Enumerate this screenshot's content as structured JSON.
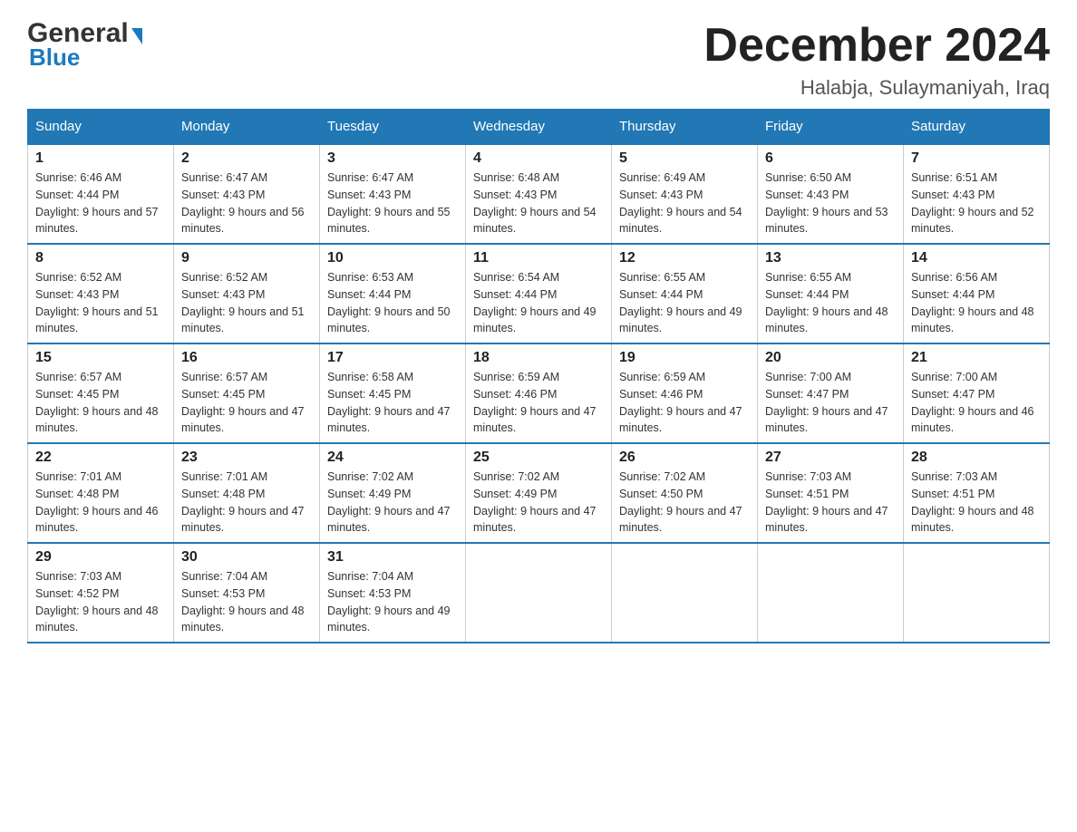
{
  "header": {
    "logo_general": "General",
    "logo_blue": "Blue",
    "month_title": "December 2024",
    "location": "Halabja, Sulaymaniyah, Iraq"
  },
  "days_of_week": [
    "Sunday",
    "Monday",
    "Tuesday",
    "Wednesday",
    "Thursday",
    "Friday",
    "Saturday"
  ],
  "weeks": [
    [
      {
        "day": "1",
        "sunrise": "6:46 AM",
        "sunset": "4:44 PM",
        "daylight": "9 hours and 57 minutes."
      },
      {
        "day": "2",
        "sunrise": "6:47 AM",
        "sunset": "4:43 PM",
        "daylight": "9 hours and 56 minutes."
      },
      {
        "day": "3",
        "sunrise": "6:47 AM",
        "sunset": "4:43 PM",
        "daylight": "9 hours and 55 minutes."
      },
      {
        "day": "4",
        "sunrise": "6:48 AM",
        "sunset": "4:43 PM",
        "daylight": "9 hours and 54 minutes."
      },
      {
        "day": "5",
        "sunrise": "6:49 AM",
        "sunset": "4:43 PM",
        "daylight": "9 hours and 54 minutes."
      },
      {
        "day": "6",
        "sunrise": "6:50 AM",
        "sunset": "4:43 PM",
        "daylight": "9 hours and 53 minutes."
      },
      {
        "day": "7",
        "sunrise": "6:51 AM",
        "sunset": "4:43 PM",
        "daylight": "9 hours and 52 minutes."
      }
    ],
    [
      {
        "day": "8",
        "sunrise": "6:52 AM",
        "sunset": "4:43 PM",
        "daylight": "9 hours and 51 minutes."
      },
      {
        "day": "9",
        "sunrise": "6:52 AM",
        "sunset": "4:43 PM",
        "daylight": "9 hours and 51 minutes."
      },
      {
        "day": "10",
        "sunrise": "6:53 AM",
        "sunset": "4:44 PM",
        "daylight": "9 hours and 50 minutes."
      },
      {
        "day": "11",
        "sunrise": "6:54 AM",
        "sunset": "4:44 PM",
        "daylight": "9 hours and 49 minutes."
      },
      {
        "day": "12",
        "sunrise": "6:55 AM",
        "sunset": "4:44 PM",
        "daylight": "9 hours and 49 minutes."
      },
      {
        "day": "13",
        "sunrise": "6:55 AM",
        "sunset": "4:44 PM",
        "daylight": "9 hours and 48 minutes."
      },
      {
        "day": "14",
        "sunrise": "6:56 AM",
        "sunset": "4:44 PM",
        "daylight": "9 hours and 48 minutes."
      }
    ],
    [
      {
        "day": "15",
        "sunrise": "6:57 AM",
        "sunset": "4:45 PM",
        "daylight": "9 hours and 48 minutes."
      },
      {
        "day": "16",
        "sunrise": "6:57 AM",
        "sunset": "4:45 PM",
        "daylight": "9 hours and 47 minutes."
      },
      {
        "day": "17",
        "sunrise": "6:58 AM",
        "sunset": "4:45 PM",
        "daylight": "9 hours and 47 minutes."
      },
      {
        "day": "18",
        "sunrise": "6:59 AM",
        "sunset": "4:46 PM",
        "daylight": "9 hours and 47 minutes."
      },
      {
        "day": "19",
        "sunrise": "6:59 AM",
        "sunset": "4:46 PM",
        "daylight": "9 hours and 47 minutes."
      },
      {
        "day": "20",
        "sunrise": "7:00 AM",
        "sunset": "4:47 PM",
        "daylight": "9 hours and 47 minutes."
      },
      {
        "day": "21",
        "sunrise": "7:00 AM",
        "sunset": "4:47 PM",
        "daylight": "9 hours and 46 minutes."
      }
    ],
    [
      {
        "day": "22",
        "sunrise": "7:01 AM",
        "sunset": "4:48 PM",
        "daylight": "9 hours and 46 minutes."
      },
      {
        "day": "23",
        "sunrise": "7:01 AM",
        "sunset": "4:48 PM",
        "daylight": "9 hours and 47 minutes."
      },
      {
        "day": "24",
        "sunrise": "7:02 AM",
        "sunset": "4:49 PM",
        "daylight": "9 hours and 47 minutes."
      },
      {
        "day": "25",
        "sunrise": "7:02 AM",
        "sunset": "4:49 PM",
        "daylight": "9 hours and 47 minutes."
      },
      {
        "day": "26",
        "sunrise": "7:02 AM",
        "sunset": "4:50 PM",
        "daylight": "9 hours and 47 minutes."
      },
      {
        "day": "27",
        "sunrise": "7:03 AM",
        "sunset": "4:51 PM",
        "daylight": "9 hours and 47 minutes."
      },
      {
        "day": "28",
        "sunrise": "7:03 AM",
        "sunset": "4:51 PM",
        "daylight": "9 hours and 48 minutes."
      }
    ],
    [
      {
        "day": "29",
        "sunrise": "7:03 AM",
        "sunset": "4:52 PM",
        "daylight": "9 hours and 48 minutes."
      },
      {
        "day": "30",
        "sunrise": "7:04 AM",
        "sunset": "4:53 PM",
        "daylight": "9 hours and 48 minutes."
      },
      {
        "day": "31",
        "sunrise": "7:04 AM",
        "sunset": "4:53 PM",
        "daylight": "9 hours and 49 minutes."
      },
      null,
      null,
      null,
      null
    ]
  ]
}
